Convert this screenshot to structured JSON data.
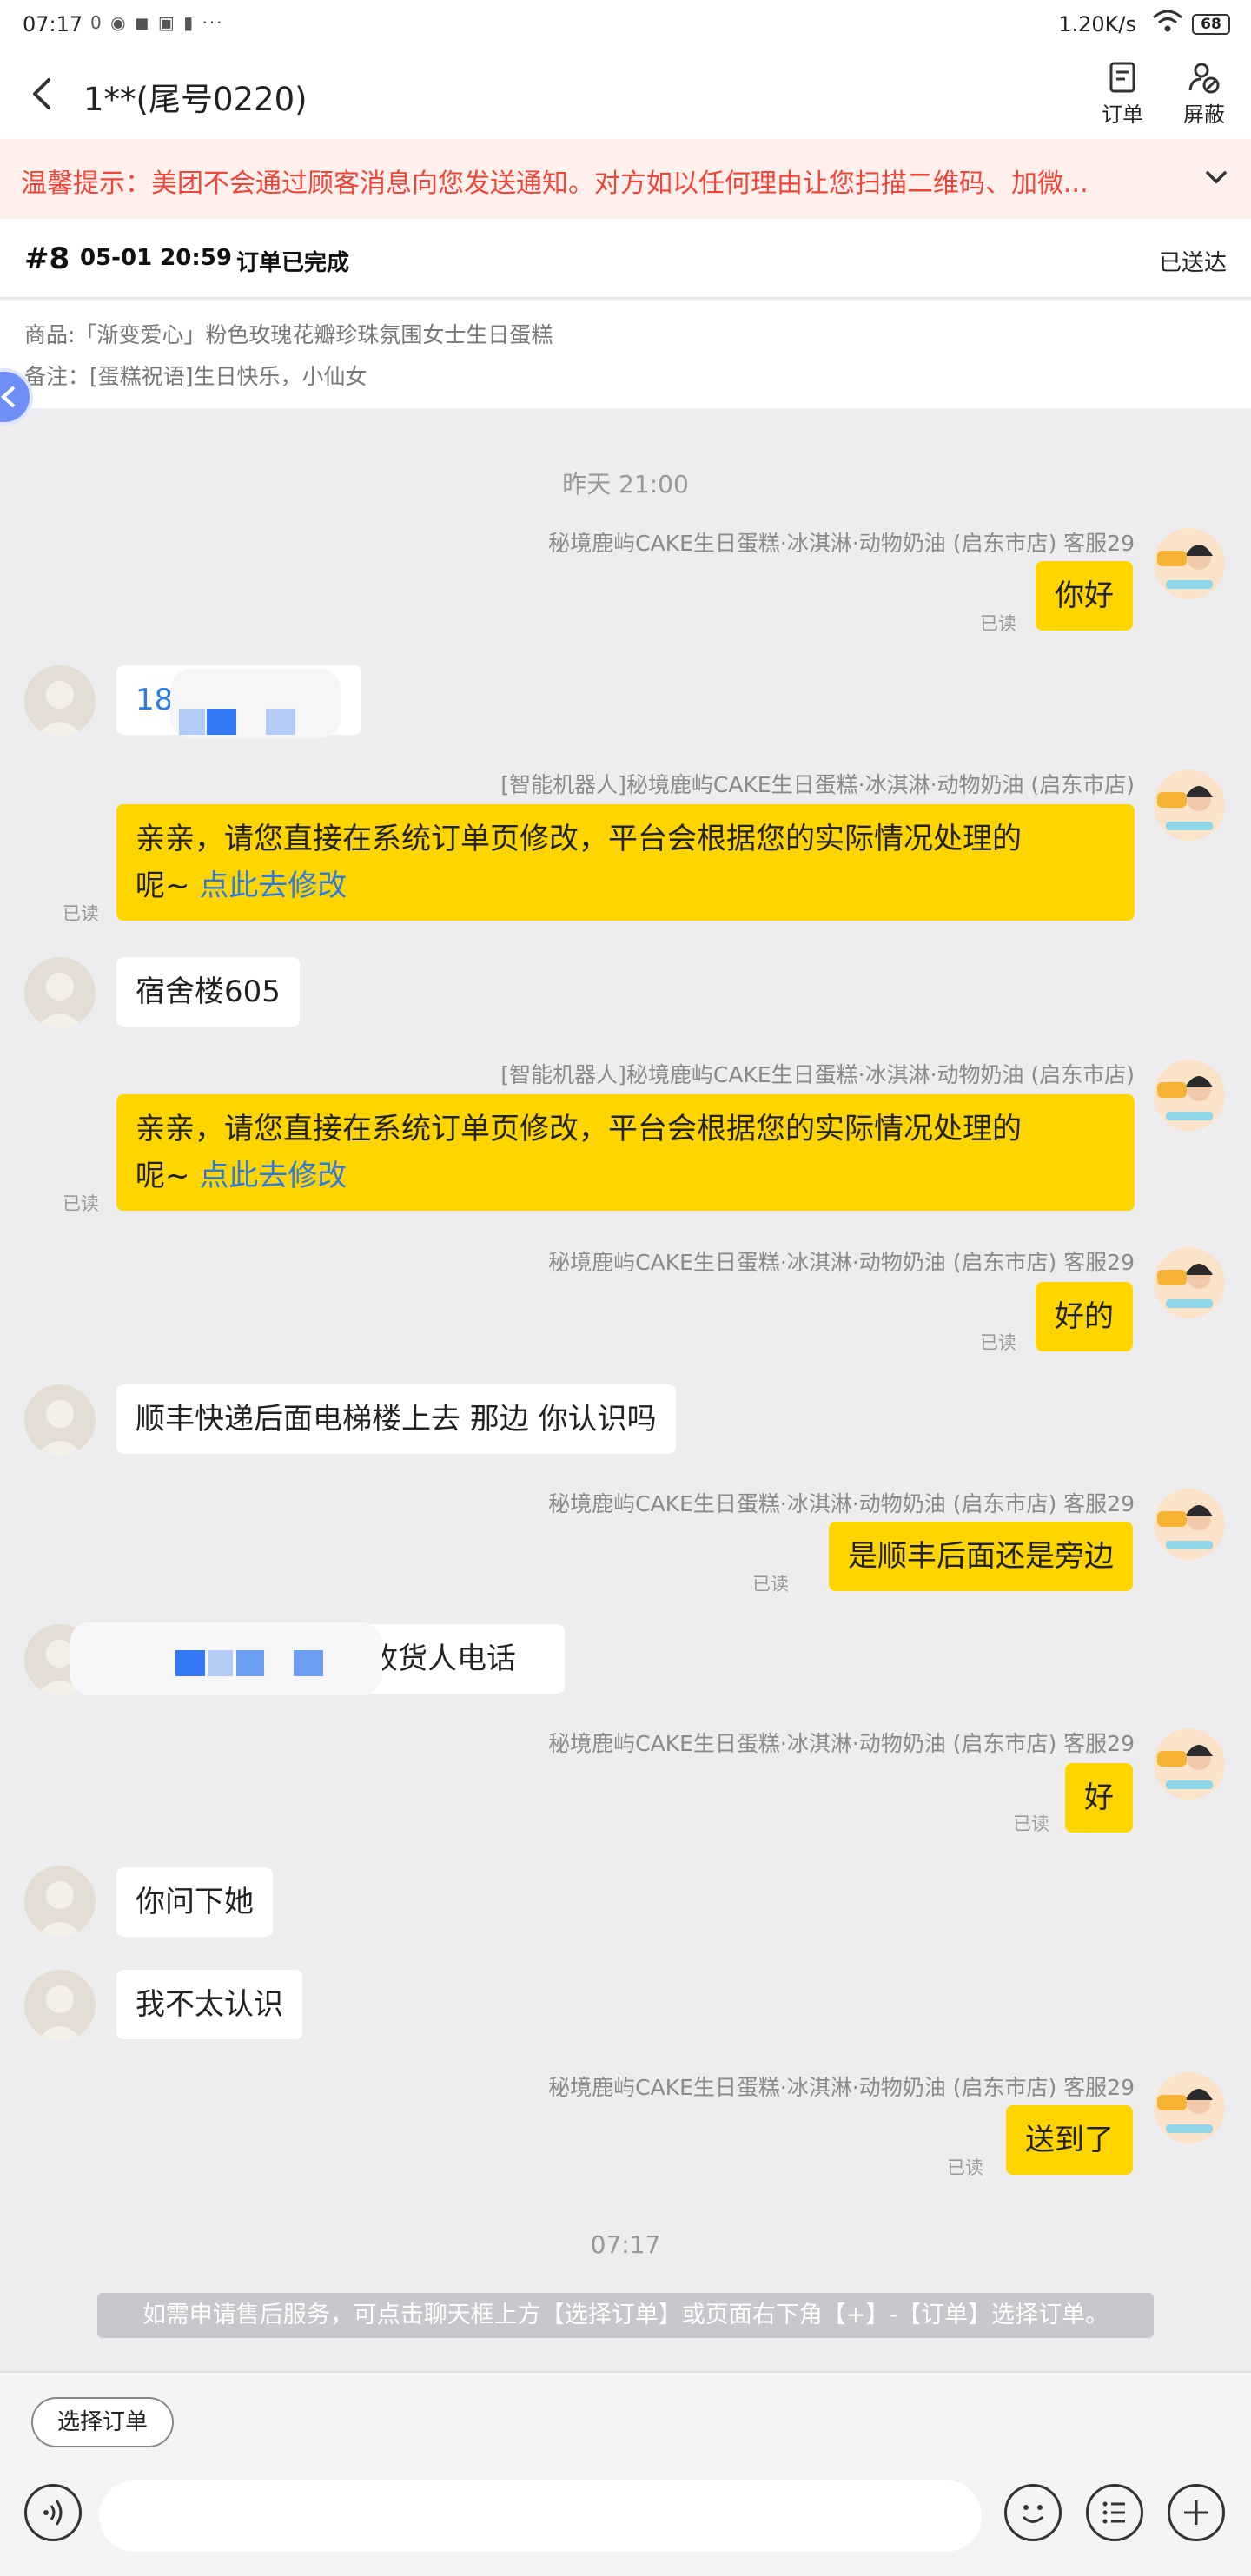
{
  "status_bar": {
    "time": "07:17",
    "notification_icons": "0 ◉ ◼ ▣ ▮ ···",
    "network_speed": "1.20K/s",
    "battery": "68"
  },
  "header": {
    "title": "1**(尾号0220)",
    "order_label": "订单",
    "block_label": "屏蔽"
  },
  "warning": {
    "text": "温馨提示：美团不会通过顾客消息向您发送通知。对方如以任何理由让您扫描二维码、加微..."
  },
  "order": {
    "number": "#8",
    "time": "05-01 20:59",
    "status": "订单已完成",
    "delivery_status": "已送达",
    "goods": "商品:「渐变爱心」粉色玫瑰花瓣珍珠氛围女士生日蛋糕",
    "note": "备注：[蛋糕祝语]生日快乐，小仙女"
  },
  "chat": {
    "divider_1": "昨天 21:00",
    "divider_2": "07:17",
    "read_label": "已读",
    "link_text": "点此去修改",
    "messages": [
      {
        "sender": "秘境鹿屿CAKE生日蛋糕·冰淇淋·动物奶油 (启东市店) 客服29",
        "text": "你好"
      },
      {
        "text": "18"
      },
      {
        "sender": "[智能机器人]秘境鹿屿CAKE生日蛋糕·冰淇淋·动物奶油 (启东市店)",
        "text": "亲亲，请您直接在系统订单页修改，平台会根据您的实际情况处理的",
        "text_2": "呢~"
      },
      {
        "text": "宿舍楼605"
      },
      {
        "sender": "[智能机器人]秘境鹿屿CAKE生日蛋糕·冰淇淋·动物奶油 (启东市店)",
        "text": "亲亲，请您直接在系统订单页修改，平台会根据您的实际情况处理的",
        "text_2": "呢~"
      },
      {
        "sender": "秘境鹿屿CAKE生日蛋糕·冰淇淋·动物奶油 (启东市店) 客服29",
        "text": "好的"
      },
      {
        "text": "顺丰快递后面电梯楼上去 那边 你认识吗"
      },
      {
        "sender": "秘境鹿屿CAKE生日蛋糕·冰淇淋·动物奶油 (启东市店) 客服29",
        "text": "是顺丰后面还是旁边"
      },
      {
        "text": "收货人电话"
      },
      {
        "sender": "秘境鹿屿CAKE生日蛋糕·冰淇淋·动物奶油 (启东市店) 客服29",
        "text": "好"
      },
      {
        "text": "你问下她"
      },
      {
        "text": "我不太认识"
      },
      {
        "sender": "秘境鹿屿CAKE生日蛋糕·冰淇淋·动物奶油 (启东市店) 客服29",
        "text": "送到了"
      }
    ]
  },
  "hint": "如需申请售后服务，可点击聊天框上方【选择订单】或页面右下角【+】-【订单】选择订单。",
  "bottom": {
    "select_order": "选择订单",
    "input_placeholder": ""
  },
  "colors": {
    "outgoing_bubble": "#ffd500",
    "warning_text": "#f0453a",
    "link": "#2c7be5"
  },
  "icons": [
    "back-icon",
    "order-icon",
    "block-icon",
    "chevron-down-icon",
    "voice-icon",
    "emoji-icon",
    "quick-reply-icon",
    "plus-icon"
  ]
}
